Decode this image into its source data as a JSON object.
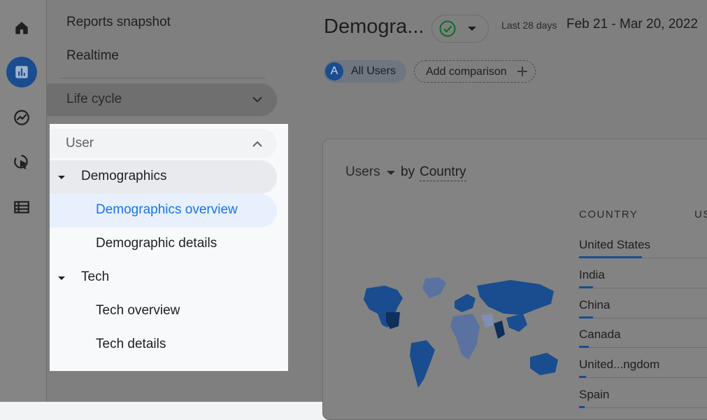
{
  "nav": {
    "reports_snapshot": "Reports snapshot",
    "realtime": "Realtime",
    "life_cycle": "Life cycle",
    "user": "User",
    "demographics": "Demographics",
    "demographics_overview": "Demographics overview",
    "demographic_details": "Demographic details",
    "tech": "Tech",
    "tech_overview": "Tech overview",
    "tech_details": "Tech details"
  },
  "rail": {
    "icons": [
      "home-icon",
      "reports-icon",
      "explore-icon",
      "advertising-icon",
      "configure-icon"
    ],
    "active": "reports-icon"
  },
  "header": {
    "title": "Demogra...",
    "date_label": "Last 28 days",
    "date_range": "Feb 21 - Mar 20, 2022"
  },
  "comparisons": {
    "badge": "A",
    "all_users": "All Users",
    "add": "Add comparison"
  },
  "card": {
    "metric": "Users",
    "by": "by",
    "dimension": "Country",
    "col_country": "COUNTRY",
    "col_users": "US",
    "countries": [
      {
        "name": "United States",
        "share": 0.45
      },
      {
        "name": "India",
        "share": 0.1
      },
      {
        "name": "China",
        "share": 0.1
      },
      {
        "name": "Canada",
        "share": 0.07
      },
      {
        "name": "United...ngdom",
        "share": 0.05
      },
      {
        "name": "Spain",
        "share": 0.04
      }
    ]
  },
  "colors": {
    "accent": "#1a73e8",
    "highlight_bg": "#e8f0fe",
    "map_dark": "#1a4d8f"
  }
}
